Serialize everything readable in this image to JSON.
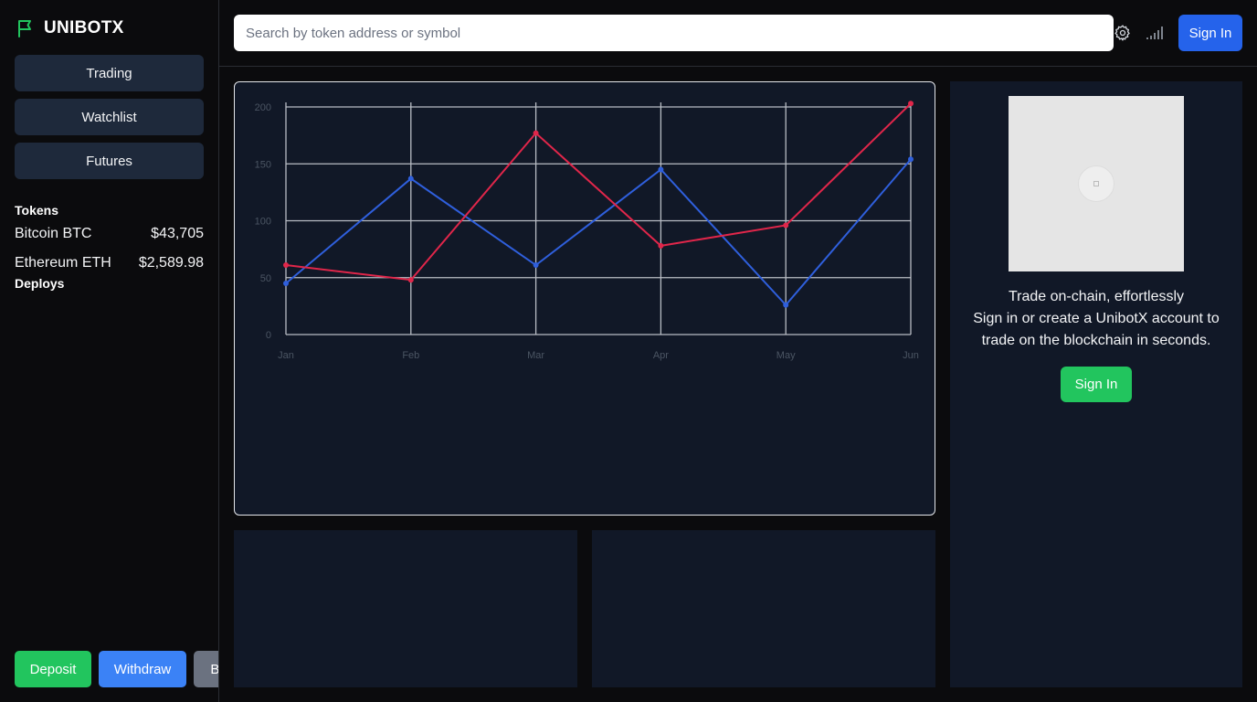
{
  "brand": {
    "name": "UNIBOTX",
    "accent": "#22c55e"
  },
  "nav": [
    {
      "label": "Trading"
    },
    {
      "label": "Watchlist"
    },
    {
      "label": "Futures"
    }
  ],
  "tokens": {
    "title": "Tokens",
    "items": [
      {
        "name": "Bitcoin BTC",
        "price": "$43,705"
      },
      {
        "name": "Ethereum ETH",
        "price": "$2,589.98"
      }
    ]
  },
  "deploys": {
    "title": "Deploys"
  },
  "actions": {
    "deposit": "Deposit",
    "withdraw": "Withdraw",
    "bridge": "Bridge"
  },
  "header": {
    "search_placeholder": "Search by token address or symbol",
    "settings_icon": "gear-icon",
    "signal_icon": "signal-bars-icon",
    "signin_label": "Sign In"
  },
  "promo": {
    "line1": "Trade on-chain, effortlessly",
    "line2": "Sign in or create a UnibotX account to trade on the blockchain in seconds.",
    "signin_label": "Sign In"
  },
  "chart_data": {
    "type": "line",
    "categories": [
      "Jan",
      "Feb",
      "Mar",
      "Apr",
      "May",
      "Jun"
    ],
    "ylim": [
      0,
      200
    ],
    "yticks": [
      0,
      50,
      100,
      150,
      200
    ],
    "grid": true,
    "series": [
      {
        "values": [
          45,
          137,
          61,
          145,
          26,
          154
        ],
        "color": "#2f5fdc"
      },
      {
        "values": [
          61,
          48,
          177,
          78,
          96,
          203
        ],
        "color": "#e0264a"
      }
    ]
  }
}
